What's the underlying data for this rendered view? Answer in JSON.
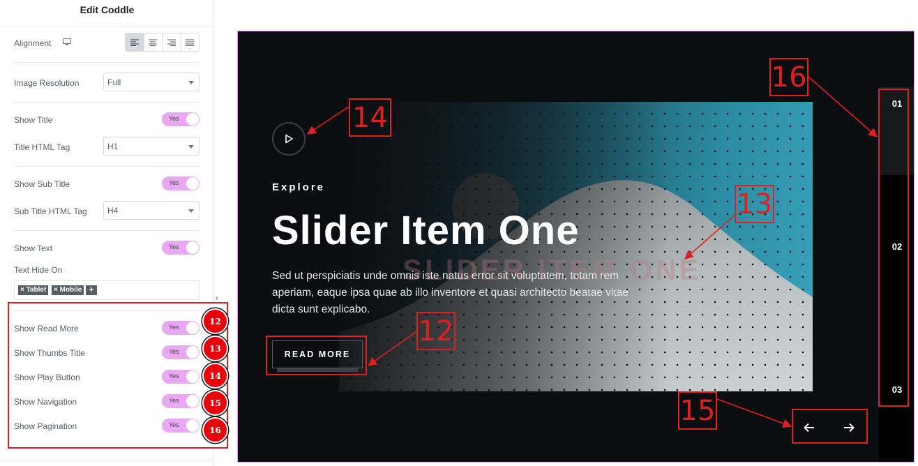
{
  "panel": {
    "title": "Edit Coddle",
    "alignment_label": "Alignment",
    "image_resolution": {
      "label": "Image Resolution",
      "value": "Full"
    },
    "show_title": {
      "label": "Show Title",
      "value": "Yes"
    },
    "title_tag": {
      "label": "Title HTML Tag",
      "value": "H1"
    },
    "show_sub_title": {
      "label": "Show Sub Title",
      "value": "Yes"
    },
    "sub_title_tag": {
      "label": "Sub Title HTML Tag",
      "value": "H4"
    },
    "show_text": {
      "label": "Show Text",
      "value": "Yes"
    },
    "text_hide_on": {
      "label": "Text Hide On",
      "tags": [
        "× Tablet",
        "× Mobile"
      ],
      "add": "+"
    },
    "toggles": [
      {
        "label": "Show Read More",
        "value": "Yes",
        "badge": "12"
      },
      {
        "label": "Show Thumbs Title",
        "value": "Yes",
        "badge": "13"
      },
      {
        "label": "Show Play Button",
        "value": "Yes",
        "badge": "14"
      },
      {
        "label": "Show Navigation",
        "value": "Yes",
        "badge": "15"
      },
      {
        "label": "Show Pagination",
        "value": "Yes",
        "badge": "16"
      }
    ],
    "collapse_glyph": "‹"
  },
  "slider": {
    "subtitle": "Explore",
    "title": "Slider Item One",
    "watermark": "SLIDER ITEM ONE",
    "description": "Sed ut perspiciatis unde omnis iste natus error sit voluptatem, totam rem aperiam, eaque ipsa quae ab illo inventore et quasi architecto beatae vitae dicta sunt explicabo.",
    "read_more": "READ MORE",
    "pagination": [
      "01",
      "02",
      "03"
    ]
  },
  "annotations": {
    "a12": "12",
    "a13": "13",
    "a14": "14",
    "a15": "15",
    "a16": "16"
  },
  "colors": {
    "accent_red": "#e02020",
    "toggle_pink": "#e9a8f2",
    "preview_bg": "#0c0d10"
  },
  "icons": [
    "monitor-icon",
    "align-left-icon",
    "align-center-icon",
    "align-right-icon",
    "align-justify-icon",
    "play-icon",
    "arrow-left-icon",
    "arrow-right-icon"
  ]
}
